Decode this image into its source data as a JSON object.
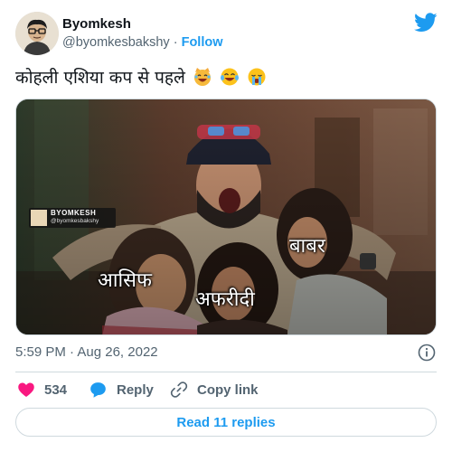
{
  "author": {
    "name": "Byomkesh",
    "handle": "@byomkesbakshy",
    "separator": "·",
    "follow_label": "Follow"
  },
  "tweet": {
    "text": "कोहली एशिया कप से पहले",
    "emojis": [
      "laughing-cat-emoji",
      "laughing-tears-emoji",
      "crying-emoji"
    ]
  },
  "media": {
    "captions": {
      "babar": "बाबर",
      "asif": "आसिफ",
      "afridi": "अफरीदी"
    },
    "watermark": {
      "name": "BYOMKESH",
      "handle": "@byomkesbakshy"
    }
  },
  "meta": {
    "time": "5:59 PM",
    "separator": "·",
    "date": "Aug 26, 2022"
  },
  "actions": {
    "like_count": "534",
    "reply_label": "Reply",
    "copy_label": "Copy link"
  },
  "replies": {
    "label": "Read 11 replies"
  },
  "colors": {
    "accent": "#1d9bf0",
    "like": "#f91880",
    "secondary_text": "#536471",
    "border": "#cfd9de"
  }
}
